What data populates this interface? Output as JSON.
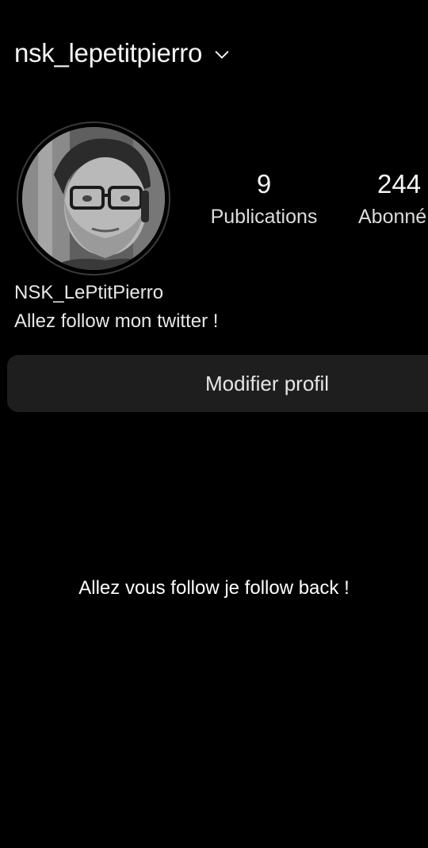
{
  "profile": {
    "username": "nsk_lepetitpierro",
    "display_name": "NSK_LePtitPierro",
    "bio": "Allez follow mon twitter !"
  },
  "stats": {
    "posts": {
      "count": "9",
      "label": "Publications"
    },
    "followers": {
      "count": "244",
      "label": "Abonné"
    }
  },
  "actions": {
    "edit_profile_label": "Modifier profil"
  },
  "overlay": {
    "caption": "Allez vous follow je follow back !"
  },
  "icons": {
    "username_dropdown": "chevron-down-icon"
  },
  "colors": {
    "background": "#000000",
    "button_bg": "#1e1e1e",
    "text": "#f2f2f2"
  }
}
